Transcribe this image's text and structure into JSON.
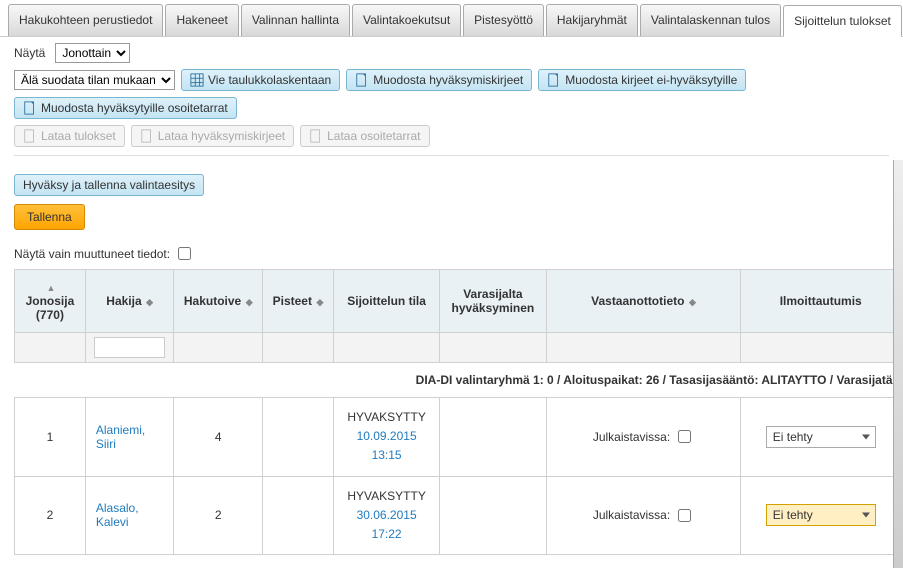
{
  "tabs": {
    "items": [
      "Hakukohteen perustiedot",
      "Hakeneet",
      "Valinnan hallinta",
      "Valintakoekutsut",
      "Pistesyöttö",
      "Hakijaryhmät",
      "Valintalaskennan tulos",
      "Sijoittelun tulokset"
    ],
    "activeIndex": 7
  },
  "controls": {
    "nayta_label": "Näytä",
    "nayta_value": "Jonottain",
    "filter_value": "Älä suodata tilan mukaan",
    "btn_vie": "Vie taulukkolaskentaan",
    "btn_hyvkirje": "Muodosta hyväksymiskirjeet",
    "btn_eihyv": "Muodosta kirjeet ei-hyväksytyille",
    "btn_osoite": "Muodosta hyväksytyille osoitetarrat",
    "btn_lataa_tulokset": "Lataa tulokset",
    "btn_lataa_hyv": "Lataa hyväksymiskirjeet",
    "btn_lataa_osoite": "Lataa osoitetarrat",
    "btn_hyvaksy_esitys": "Hyväksy ja tallenna valintaesitys",
    "btn_tallenna": "Tallenna",
    "muuttuneet_label": "Näytä vain muuttuneet tiedot:"
  },
  "table": {
    "headers": {
      "jonosija": "Jonosija (770)",
      "hakija": "Hakija",
      "hakutoive": "Hakutoive",
      "pisteet": "Pisteet",
      "sijoittelun_tila": "Sijoittelun tila",
      "varasijalta": "Varasijalta hyväksyminen",
      "vastaanotto": "Vastaanottotieto",
      "ilmoittautumis": "Ilmoittautumis"
    },
    "group_header": "DIA-DI valintaryhmä 1: 0 / Aloituspaikat: 26 / Tasasijasääntö: ALITAYTTO / Varasijatä",
    "rows": [
      {
        "jonosija": "1",
        "hakija_fn": "Alaniemi,",
        "hakija_ln": "Siiri",
        "hakutoive": "4",
        "status": "HYVAKSYTTY",
        "status_date": "10.09.2015",
        "status_time": "13:15",
        "julk_label": "Julkaistavissa:",
        "ilm_value": "Ei tehty",
        "highlight": false
      },
      {
        "jonosija": "2",
        "hakija_fn": "Alasalo,",
        "hakija_ln": "Kalevi",
        "hakutoive": "2",
        "status": "HYVAKSYTTY",
        "status_date": "30.06.2015",
        "status_time": "17:22",
        "julk_label": "Julkaistavissa:",
        "ilm_value": "Ei tehty",
        "highlight": true
      }
    ]
  }
}
